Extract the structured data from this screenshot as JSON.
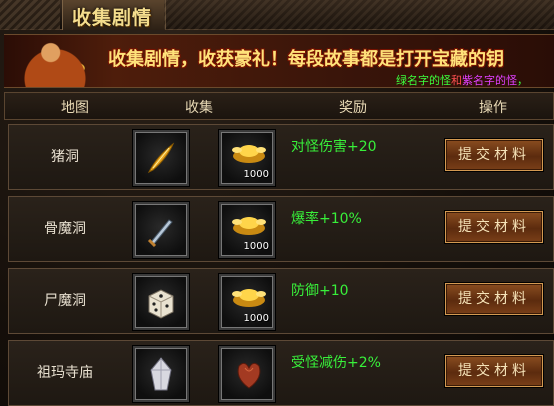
{
  "window": {
    "title": "收集剧情"
  },
  "banner": {
    "headline": "收集剧情，收获豪礼！每段故事都是打开宝藏的钥",
    "sub_parts": [
      {
        "text": "绿名字的怪",
        "color": "#3cff3c"
      },
      {
        "text": "和",
        "color": "#ff5050"
      },
      {
        "text": "紫名字的怪",
        "color": "#e040ff"
      },
      {
        "text": "，",
        "color": "#3cff3c"
      }
    ]
  },
  "table": {
    "headers": {
      "map": "地图",
      "collect": "收集",
      "reward": "奖励",
      "action": "操作"
    },
    "rows": [
      {
        "map": "猪洞",
        "item1_icon": "feather-icon",
        "item2_icon": "gold-ingot-icon",
        "item2_qty": "1000",
        "reward": "对怪伤害+20",
        "button": "提交材料"
      },
      {
        "map": "骨魔洞",
        "item1_icon": "dagger-icon",
        "item2_icon": "gold-ingot-icon",
        "item2_qty": "1000",
        "reward": "爆率+10%",
        "button": "提交材料"
      },
      {
        "map": "尸魔洞",
        "item1_icon": "dice-icon",
        "item2_icon": "gold-ingot-icon",
        "item2_qty": "1000",
        "reward": "防御+10",
        "button": "提交材料"
      },
      {
        "map": "祖玛寺庙",
        "item1_icon": "crystal-icon",
        "item2_icon": "heart-organ-icon",
        "item2_qty": "",
        "reward": "受怪减伤+2%",
        "button": "提交材料"
      }
    ]
  },
  "colors": {
    "reward": "#38f03a",
    "headline": "#ffe27a",
    "title": "#f4dd8d"
  }
}
